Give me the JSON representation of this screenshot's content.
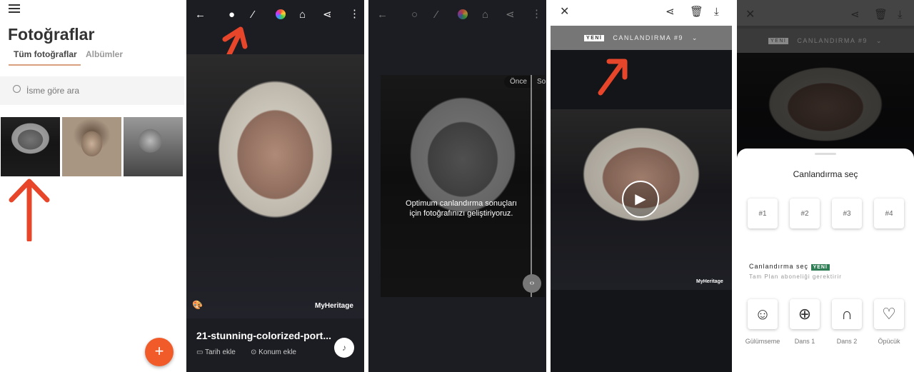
{
  "gallery": {
    "title": "Fotoğraflar",
    "tabs": [
      {
        "label": "Tüm fotoğraflar",
        "active": true
      },
      {
        "label": "Albümler",
        "active": false
      }
    ],
    "search_placeholder": "İsme göre ara",
    "accent": "#f15a29",
    "fab_icon": "plus-icon"
  },
  "viewer": {
    "photo_title": "21-stunning-colorized-port...",
    "date_label": "Tarih ekle",
    "location_label": "Konum ekle",
    "watermark": "MyHeritage"
  },
  "enhance": {
    "before_label": "Önce",
    "after_label": "So",
    "message": "Optimum canlandırma sonuçları için fotoğrafınızı geliştiriyoruz."
  },
  "animation": {
    "new_badge": "YENİ",
    "title": "CANLANDIRMA #9",
    "watermark": "MyHeritage"
  },
  "sheet": {
    "title": "Canlandırma seç",
    "options": [
      "#1",
      "#2",
      "#3",
      "#4"
    ],
    "section_title": "Canlandırma seç",
    "section_badge": "YENİ",
    "section_subtitle": "Tam Plan aboneliği gerektirir",
    "effects": [
      {
        "label": "Gülümseme",
        "icon": "smile-icon"
      },
      {
        "label": "Dans 1",
        "icon": "disco-ball-icon"
      },
      {
        "label": "Dans 2",
        "icon": "headphones-icon"
      },
      {
        "label": "Öpücük",
        "icon": "kiss-icon"
      }
    ]
  },
  "annotation_color": "#e8462a"
}
